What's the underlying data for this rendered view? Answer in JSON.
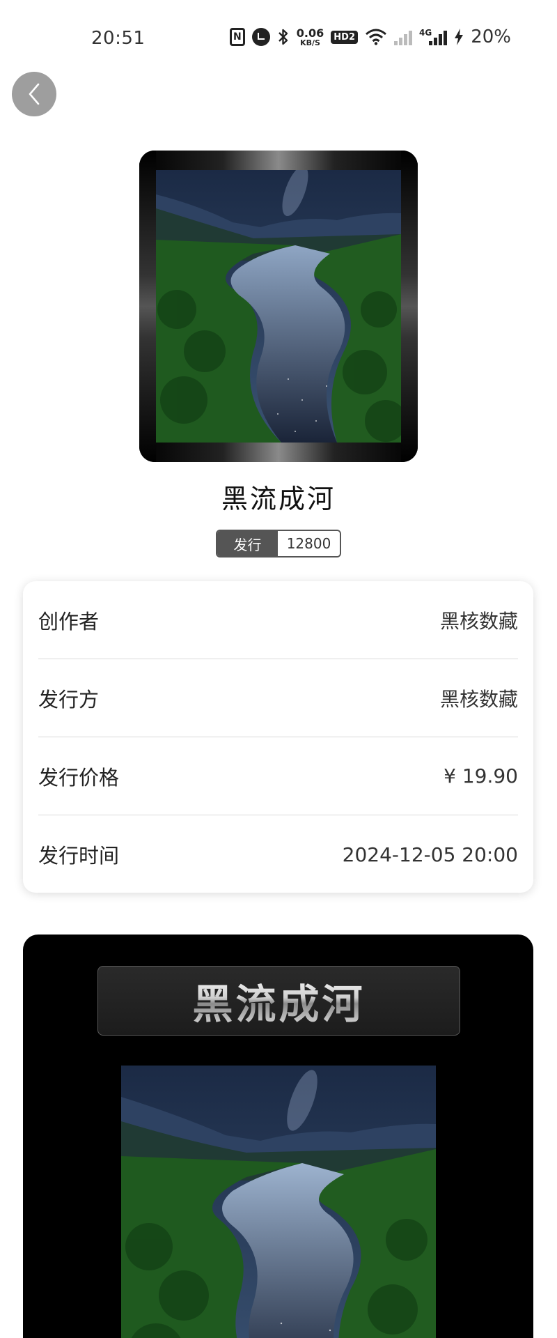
{
  "status_bar": {
    "time": "20:51",
    "speed_value": "0.06",
    "speed_unit": "KB/S",
    "hd_label": "HD2",
    "network_label": "4G",
    "battery": "20%",
    "icons": [
      "nfc-icon",
      "alarm-icon",
      "bluetooth-icon",
      "hd-icon",
      "wifi-icon",
      "signal-icon",
      "charging-icon"
    ]
  },
  "nav": {
    "back_icon": "chevron-left-icon"
  },
  "nft": {
    "title": "黑流成河",
    "issue_label": "发行",
    "issue_count": "12800"
  },
  "info": {
    "rows": [
      {
        "key": "创作者",
        "value": "黑核数藏"
      },
      {
        "key": "发行方",
        "value": "黑核数藏"
      },
      {
        "key": "发行价格",
        "value": "¥ 19.90"
      },
      {
        "key": "发行时间",
        "value": "2024-12-05 20:00"
      }
    ]
  },
  "detail": {
    "title": "黑流成河"
  },
  "colors": {
    "back_button_bg": "#9e9e9e",
    "badge_dark": "#555555",
    "panel_bg": "#000000",
    "card_bg": "#ffffff"
  }
}
